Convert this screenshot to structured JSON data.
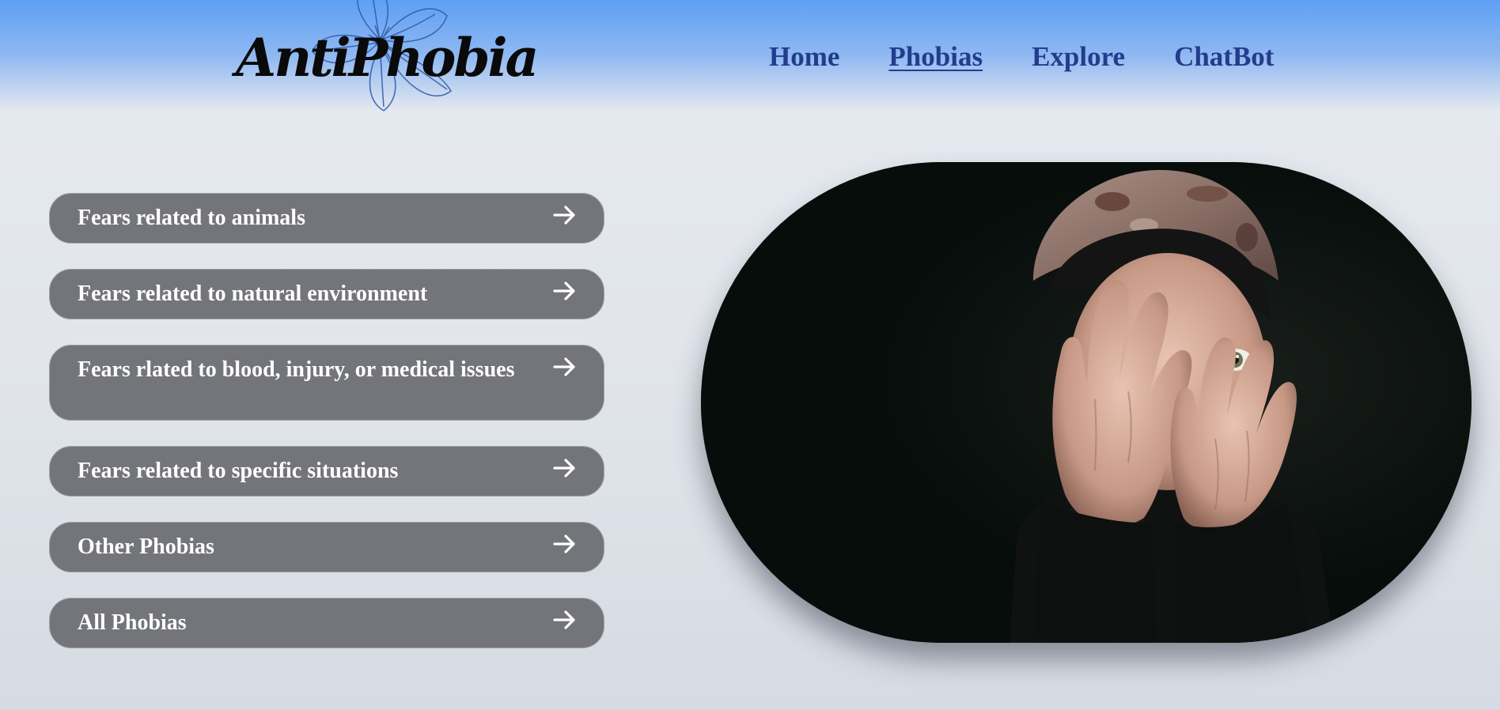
{
  "brand": {
    "logo_text": "AntiPhobia"
  },
  "nav": {
    "items": [
      {
        "label": "Home"
      },
      {
        "label": "Phobias"
      },
      {
        "label": "Explore"
      },
      {
        "label": "ChatBot"
      }
    ],
    "active": "Phobias",
    "color": "#233c8c"
  },
  "categories": [
    {
      "label": "Fears related to animals"
    },
    {
      "label": "Fears related to natural environment"
    },
    {
      "label": "Fears rlated to blood, injury, or medical issues"
    },
    {
      "label": "Fears related to specific situations"
    },
    {
      "label": "Other Phobias"
    },
    {
      "label": "All Phobias"
    }
  ],
  "icons": {
    "category_arrow": "arrow-right-icon",
    "logo_decoration": "flower-icon"
  },
  "hero": {
    "image": "child-covering-face-photo"
  },
  "colors": {
    "header_gradient_top": "#5e9ff5",
    "page_background": "#e2e6ec",
    "category_button": "#74757a",
    "category_text": "#ffffff",
    "hero_background": "#070d0a"
  }
}
